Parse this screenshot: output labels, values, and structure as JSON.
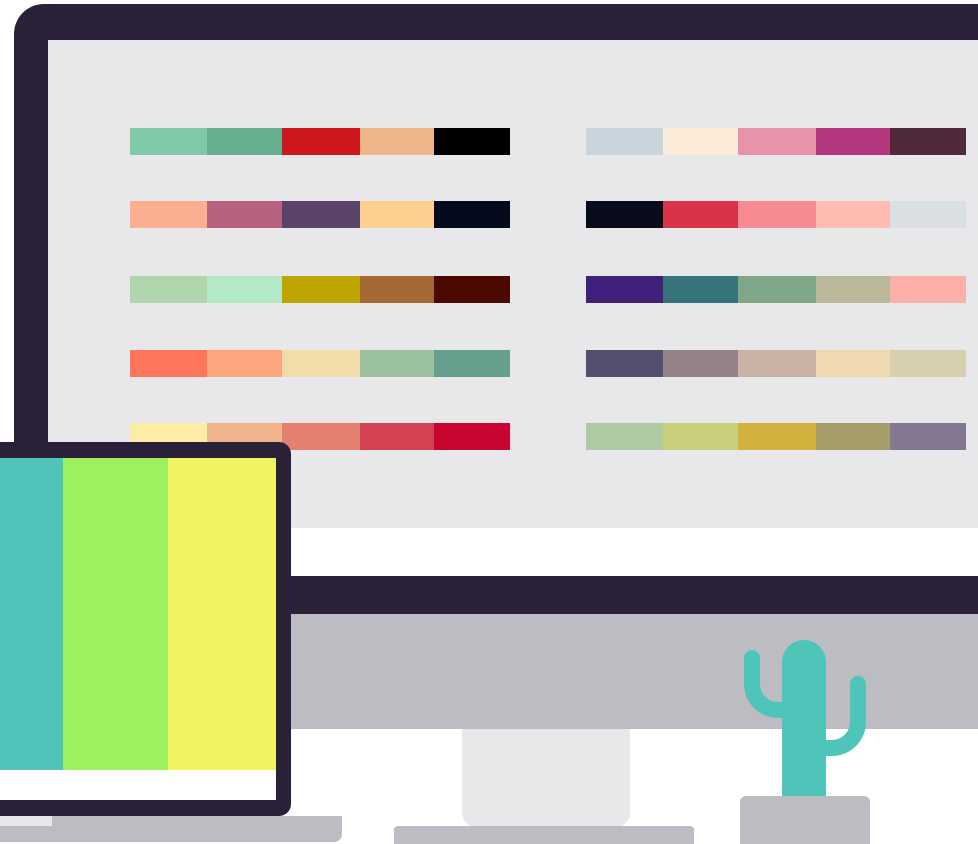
{
  "colors": {
    "frame": "#2a2038",
    "screen": "#e8e8ea",
    "chin": "#bcbcc2",
    "cactus": "#4fc4b8"
  },
  "palettes_left": [
    [
      "#7fcba8",
      "#66b08f",
      "#cf171d",
      "#edb78a",
      "#000000"
    ],
    [
      "#fcae90",
      "#b86180",
      "#5b4469",
      "#fdd08f",
      "#040b1c"
    ],
    [
      "#b0d5ad",
      "#b4e9c8",
      "#bfa500",
      "#a56a33",
      "#4b0900"
    ],
    [
      "#fd755a",
      "#fda57c",
      "#f2dcaa",
      "#9cc19f",
      "#679f8f"
    ],
    [
      "#fdeca5",
      "#efb48b",
      "#e57f6f",
      "#d54352",
      "#c80530"
    ]
  ],
  "palettes_right": [
    [
      "#c8d5dd",
      "#fbebd8",
      "#e993aa",
      "#b5387f",
      "#4e2a3b"
    ],
    [
      "#080b1c",
      "#d93349",
      "#f88b92",
      "#fdbcb2",
      "#dadfe3"
    ],
    [
      "#41207b",
      "#377479",
      "#80a688",
      "#bbb79b",
      "#fcafa8"
    ],
    [
      "#534f6e",
      "#93828a",
      "#c9b2a3",
      "#eed9b1",
      "#d8cfaf"
    ],
    [
      "#aecba4",
      "#c9cf7b",
      "#d2b13f",
      "#a69e6a",
      "#83788f"
    ]
  ],
  "laptop_stripes": [
    "#4fc4b8",
    "#9ff05f",
    "#f2f363"
  ]
}
